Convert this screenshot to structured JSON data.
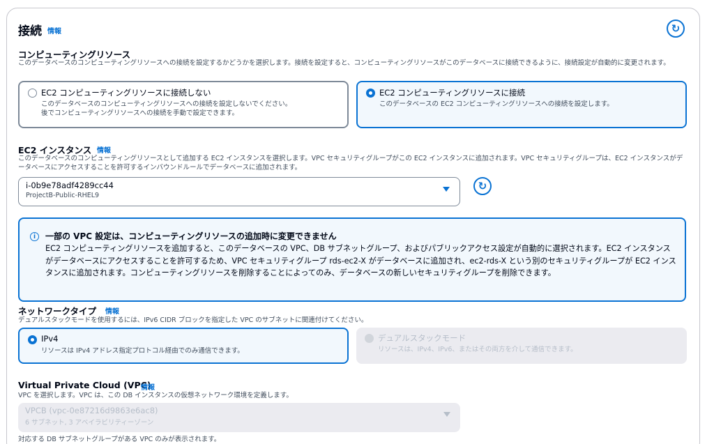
{
  "connection": {
    "title": "接続",
    "info": "情報"
  },
  "compute": {
    "title": "コンピューティングリソース",
    "description": "このデータベースのコンピューティングリソースへの接続を設定するかどうかを選択します。接続を設定すると、コンピューティングリソースがこのデータベースに接続できるように、接続設定が自動的に変更されます。",
    "options": [
      {
        "label": "EC2 コンピューティングリソースに接続しない",
        "desc1": "このデータベースのコンピューティングリソースへの接続を設定しないでください。",
        "desc2": "後でコンピューティングリソースへの接続を手動で設定できます。",
        "selected": false
      },
      {
        "label": "EC2 コンピューティングリソースに接続",
        "desc1": "このデータベースの EC2 コンピューティングリソースへの接続を設定します。",
        "selected": true
      }
    ]
  },
  "ec2": {
    "title": "EC2 インスタンス",
    "info": "情報",
    "description": "このデータベースのコンピューティングリソースとして追加する EC2 インスタンスを選択します。VPC セキュリティグループがこの EC2 インスタンスに追加されます。VPC セキュリティグループは、EC2 インスタンスがデータベースにアクセスすることを許可するインバウンドルールでデータベースに追加されます。",
    "selected_id": "i-0b9e78adf4289cc44",
    "selected_name": "ProjectB-Public-RHEL9"
  },
  "alert": {
    "title": "一部の VPC 設定は、コンピューティングリソースの追加時に変更できません",
    "body": "EC2 コンピューティングリソースを追加すると、このデータベースの VPC、DB サブネットグループ、およびパブリックアクセス設定が自動的に選択されます。EC2 インスタンスがデータベースにアクセスすることを許可するため、VPC セキュリティグループ rds-ec2-X がデータベースに追加され、ec2-rds-X という別のセキュリティグループが EC2 インスタンスに追加されます。コンピューティングリソースを削除することによってのみ、データベースの新しいセキュリティグループを削除できます。"
  },
  "network": {
    "title": "ネットワークタイプ",
    "info": "情報",
    "description": "デュアルスタックモードを使用するには、IPv6 CIDR ブロックを指定した VPC のサブネットに関連付けてください。",
    "options": [
      {
        "label": "IPv4",
        "desc": "リソースは IPv4 アドレス指定プロトコル経由でのみ通信できます。",
        "selected": true,
        "disabled": false
      },
      {
        "label": "デュアルスタックモード",
        "desc": "リソースは、IPv4、IPv6、またはその両方を介して通信できます。",
        "selected": false,
        "disabled": true
      }
    ]
  },
  "vpc": {
    "title": "Virtual Private Cloud (VPC)",
    "info": "情報",
    "description": "VPC を選択します。VPC は、この DB インスタンスの仮想ネットワーク環境を定義します。",
    "selected": "VPCB (vpc-0e87216d9863e6ac8)",
    "subtext": "6 サブネット, 3 アベイラビリティーゾーン",
    "footnote": "対応する DB サブネットグループがある VPC のみが表示されます。"
  },
  "colors": {
    "accent": "#0972d3",
    "text": "#000716",
    "secondary_text": "#414d5c",
    "selected_bg": "#f2f8fd",
    "disabled_bg": "#ebebf0"
  },
  "icons": {
    "refresh": "refresh-icon",
    "info": "info-circle-icon",
    "caret": "caret-down-icon"
  }
}
